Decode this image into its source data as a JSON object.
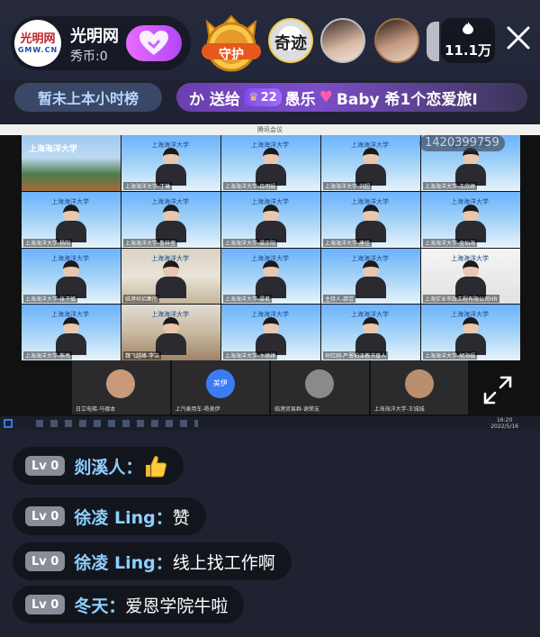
{
  "anchor": {
    "logo_line1": "光明网",
    "logo_line2": "GMW.CN",
    "name": "光明网",
    "coins": "秀币:0"
  },
  "guard": {
    "label": "守护"
  },
  "viewers": {
    "first_label": "奇迹",
    "count": "11.1万"
  },
  "rank": {
    "label": "暂未上本小时榜"
  },
  "ticker": {
    "prefix": "か 送给",
    "level": "22",
    "receiver": "愚乐",
    "suffix": "Baby 希1个恋爱旅Ⅰ"
  },
  "meeting": {
    "window_title": "腾讯会议",
    "room_id": "1420399759",
    "university_name": "上海海洋大学",
    "tiles": [
      {
        "name": ""
      },
      {
        "name": "上海海洋大学-丁琳"
      },
      {
        "name": "上海海洋大学-吕明娟"
      },
      {
        "name": "上海海洋大学-刘超"
      },
      {
        "name": "上海海洋大学-王欣婷"
      },
      {
        "name": "上海海洋大学-杨阳"
      },
      {
        "name": "上海海洋大学-鲁梓萱"
      },
      {
        "name": "上海海洋大学-梁正阳"
      },
      {
        "name": "上海海洋大学-唐佳"
      },
      {
        "name": "上海海洋大学-金仙海"
      },
      {
        "name": "上海海洋大学-张子毓"
      },
      {
        "name": "临港校招集团"
      },
      {
        "name": "上海海洋大学-梁茗"
      },
      {
        "name": "主持人-邵芸"
      },
      {
        "name": "上海实业市政工程有限公司HR"
      },
      {
        "name": "上海海洋大学-熊亮"
      },
      {
        "name": "魏飞越峰-李洁"
      },
      {
        "name": "上海海洋大学-卞婷婷"
      },
      {
        "name": "孙红刚-严恩柏泽教书育人"
      },
      {
        "name": "上海海洋大学-胡海娟"
      }
    ],
    "thumbs": [
      {
        "name": "日立电梯-马德本"
      },
      {
        "name": "上汽乘用车-杨美伊",
        "avatar_text": "美伊"
      },
      {
        "name": "临港贸易群-谢荣友"
      },
      {
        "name": "上海海洋大学-王城城"
      }
    ],
    "clock_time": "16:20",
    "clock_date": "2022/5/16"
  },
  "chat": [
    {
      "level": "Lv 0",
      "user": "剡溪人：",
      "text": ""
    },
    {
      "level": "Lv 0",
      "user": "徐凌 Ling：",
      "text": "赞"
    },
    {
      "level": "Lv 0",
      "user": "徐凌 Ling：",
      "text": "线上找工作啊"
    },
    {
      "level": "Lv 0",
      "user": "冬天：",
      "text": "爱恩学院牛啦"
    }
  ],
  "colors": {
    "background": "#1f2230",
    "username": "#8fd0ff",
    "follow_button": "#b247f5",
    "rank_text": "#b9d7ff"
  },
  "icons": [
    "heart-icon",
    "guard-badge-icon",
    "fire-icon",
    "close-icon",
    "crown-icon",
    "thumbs-up-icon",
    "expand-icon",
    "windows-icon"
  ]
}
